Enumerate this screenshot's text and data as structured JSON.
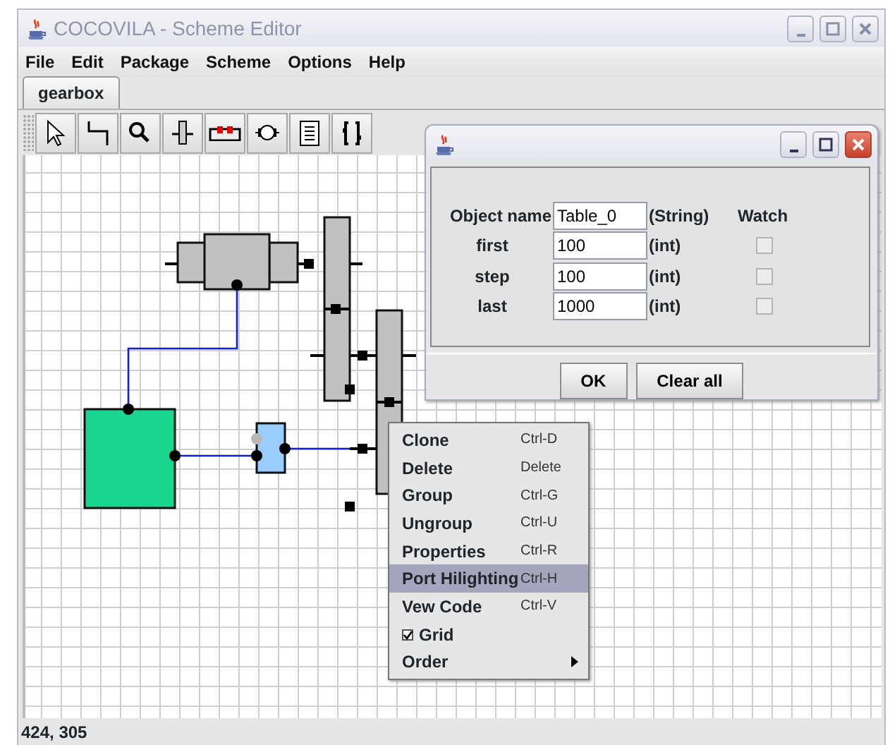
{
  "window": {
    "title": "COCOVILA - Scheme Editor"
  },
  "menu": [
    {
      "label": "File"
    },
    {
      "label": "Edit"
    },
    {
      "label": "Package"
    },
    {
      "label": "Scheme"
    },
    {
      "label": "Options"
    },
    {
      "label": "Help"
    }
  ],
  "tabs": [
    {
      "label": "gearbox",
      "selected": true
    }
  ],
  "dialog": {
    "fields": [
      {
        "label": "Object name",
        "value": "Table_0",
        "type": "(String)"
      },
      {
        "label": "first",
        "value": "100",
        "type": "(int)",
        "watch": false
      },
      {
        "label": "step",
        "value": "100",
        "type": "(int)",
        "watch": false
      },
      {
        "label": "last",
        "value": "1000",
        "type": "(int)",
        "watch": false
      }
    ],
    "watch_header": "Watch",
    "buttons": [
      "OK",
      "Clear all"
    ]
  },
  "context_menu": [
    {
      "kind": "item",
      "label": "Clone",
      "shortcut": "Ctrl-D",
      "selected": false
    },
    {
      "kind": "item",
      "label": "Delete",
      "shortcut": "Delete",
      "selected": false
    },
    {
      "kind": "item",
      "label": "Group",
      "shortcut": "Ctrl-G",
      "selected": false
    },
    {
      "kind": "item",
      "label": "Ungroup",
      "shortcut": "Ctrl-U",
      "selected": false
    },
    {
      "kind": "item",
      "label": "Properties",
      "shortcut": "Ctrl-R",
      "selected": false
    },
    {
      "kind": "item",
      "label": "Port Hilighting",
      "shortcut": "Ctrl-H",
      "selected": true
    },
    {
      "kind": "item",
      "label": "Vew Code",
      "shortcut": "Ctrl-V",
      "selected": false
    },
    {
      "kind": "check",
      "label": "Grid",
      "checked": true,
      "selected": false
    },
    {
      "kind": "submenu",
      "label": "Order",
      "selected": false
    }
  ],
  "status_bar": "424, 305"
}
